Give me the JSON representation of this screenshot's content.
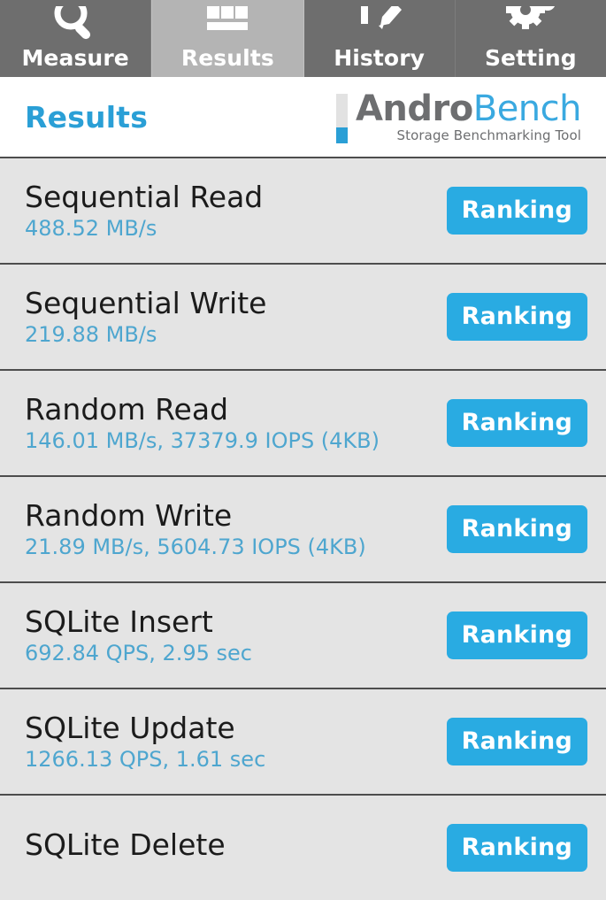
{
  "tabs": [
    {
      "label": "Measure",
      "icon": "magnifier-icon",
      "active": false
    },
    {
      "label": "Results",
      "icon": "bar-chart-icon",
      "active": true
    },
    {
      "label": "History",
      "icon": "clipboard-pencil-icon",
      "active": false
    },
    {
      "label": "Setting",
      "icon": "gear-icon",
      "active": false
    }
  ],
  "header": {
    "title": "Results",
    "brand_primary": "Andro",
    "brand_secondary": "Bench",
    "brand_tagline": "Storage Benchmarking Tool"
  },
  "results": [
    {
      "title": "Sequential Read",
      "value": "488.52 MB/s",
      "button": "Ranking"
    },
    {
      "title": "Sequential Write",
      "value": "219.88 MB/s",
      "button": "Ranking"
    },
    {
      "title": "Random Read",
      "value": "146.01 MB/s, 37379.9 IOPS (4KB)",
      "button": "Ranking"
    },
    {
      "title": "Random Write",
      "value": "21.89 MB/s, 5604.73 IOPS (4KB)",
      "button": "Ranking"
    },
    {
      "title": "SQLite Insert",
      "value": "692.84 QPS, 2.95 sec",
      "button": "Ranking"
    },
    {
      "title": "SQLite Update",
      "value": "1266.13 QPS, 1.61 sec",
      "button": "Ranking"
    },
    {
      "title": "SQLite Delete",
      "value": "",
      "button": "Ranking"
    }
  ],
  "colors": {
    "accent_blue": "#29abe2",
    "value_blue": "#4ea6cf",
    "title_blue": "#2a9fd6",
    "tab_inactive": "#6e6e6e",
    "tab_active": "#b4b4b4",
    "row_background": "#e4e4e4",
    "row_divider": "#4d4d4d",
    "brand_gray": "#6d6e70"
  }
}
